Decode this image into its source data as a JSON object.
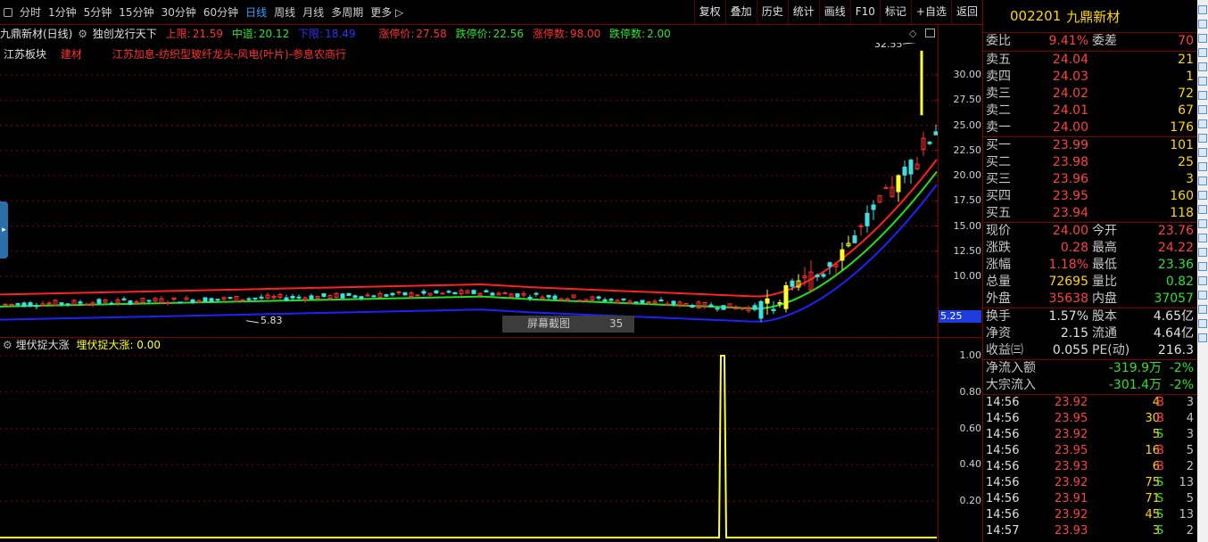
{
  "toolbar": {
    "periods": [
      {
        "label": "分时"
      },
      {
        "label": "1分钟"
      },
      {
        "label": "5分钟"
      },
      {
        "label": "15分钟"
      },
      {
        "label": "30分钟"
      },
      {
        "label": "60分钟"
      },
      {
        "label": "日线",
        "active": true
      },
      {
        "label": "周线"
      },
      {
        "label": "月线"
      },
      {
        "label": "多周期"
      },
      {
        "label": "更多 ▷"
      }
    ],
    "tools": [
      "复权",
      "叠加",
      "历史",
      "统计",
      "画线",
      "F10",
      "标记",
      "+自选",
      "返回"
    ]
  },
  "info": {
    "stock_title": "九鼎新材(日线)",
    "indicator_name": "独创龙行天下",
    "upper_label": "上限:",
    "upper_value": "21.59",
    "mid_label": "中道:",
    "mid_value": "20.12",
    "lower_label": "下限:",
    "lower_value": "18.49",
    "limit_up_label": "涨停价:",
    "limit_up_value": "27.58",
    "limit_down_label": "跌停价:",
    "limit_down_value": "22.56",
    "limit_up_count_label": "涨停数:",
    "limit_up_count_value": "98.00",
    "limit_down_count_label": "跌停数:",
    "limit_down_count_value": "2.00"
  },
  "tags": {
    "sector": "江苏板块",
    "industry": "建材",
    "concepts": "江苏加息-纺织型玻纤龙头-风电(叶片)-参息农商行"
  },
  "main_chart": {
    "y_ticks": [
      "30.00",
      "27.50",
      "25.00",
      "22.50",
      "20.00",
      "17.50",
      "15.00",
      "12.50",
      "10.00"
    ],
    "high_label": "32.55",
    "low_label": "5.83",
    "current_price_tag": "5.25",
    "colors": {
      "upper": "#ff2020",
      "middle": "#20e020",
      "lower": "#2020ff",
      "up_candle": "#ff3030",
      "down_candle": "#40e0e0",
      "highlight": "#ffff30"
    }
  },
  "popup": {
    "label": "屏幕截图",
    "value": "35"
  },
  "sub_chart": {
    "indicator_name": "埋伏捉大涨",
    "value_label": "埋伏捉大涨: 0.00",
    "y_ticks": [
      "1.00",
      "0.80",
      "0.60",
      "0.40",
      "0.20"
    ],
    "signal_value": 1.0,
    "baseline_value": 0.0
  },
  "quote": {
    "code": "002201",
    "name": "九鼎新材",
    "weibi_label": "委比",
    "weibi_value": "9.41%",
    "weicha_label": "委差",
    "weicha_value": "70",
    "asks": [
      {
        "label": "卖五",
        "price": "24.04",
        "vol": "21"
      },
      {
        "label": "卖四",
        "price": "24.03",
        "vol": "1"
      },
      {
        "label": "卖三",
        "price": "24.02",
        "vol": "72"
      },
      {
        "label": "卖二",
        "price": "24.01",
        "vol": "67"
      },
      {
        "label": "卖一",
        "price": "24.00",
        "vol": "176"
      }
    ],
    "bids": [
      {
        "label": "买一",
        "price": "23.99",
        "vol": "101"
      },
      {
        "label": "买二",
        "price": "23.98",
        "vol": "25"
      },
      {
        "label": "买三",
        "price": "23.96",
        "vol": "3"
      },
      {
        "label": "买四",
        "price": "23.95",
        "vol": "160"
      },
      {
        "label": "买五",
        "price": "23.94",
        "vol": "118"
      }
    ],
    "stats": [
      {
        "l1": "现价",
        "v1": "24.00",
        "l2": "今开",
        "v2": "23.76",
        "c1": "#ff4040",
        "c2": "#ff4040"
      },
      {
        "l1": "涨跌",
        "v1": "0.28",
        "l2": "最高",
        "v2": "24.22",
        "c1": "#ff4040",
        "c2": "#ff4040"
      },
      {
        "l1": "涨幅",
        "v1": "1.18%",
        "l2": "最低",
        "v2": "23.36",
        "c1": "#ff4040",
        "c2": "#30e030"
      },
      {
        "l1": "总量",
        "v1": "72695",
        "l2": "量比",
        "v2": "0.82",
        "c1": "#ffd700",
        "c2": "#30e030"
      },
      {
        "l1": "外盘",
        "v1": "35638",
        "l2": "内盘",
        "v2": "37057",
        "c1": "#ff4040",
        "c2": "#30e030"
      }
    ],
    "stats2": [
      {
        "l1": "换手",
        "v1": "1.57%",
        "l2": "股本",
        "v2": "4.65亿"
      },
      {
        "l1": "净资",
        "v1": "2.15",
        "l2": "流通",
        "v2": "4.64亿"
      },
      {
        "l1": "收益㈢",
        "v1": "0.055",
        "l2": "PE(动)",
        "v2": "216.3"
      }
    ],
    "flows": [
      {
        "label": "净流入额",
        "value": "-319.9万",
        "pct": "-2%"
      },
      {
        "label": "大宗流入",
        "value": "-301.4万",
        "pct": "-2%"
      }
    ],
    "ticks": [
      {
        "time": "14:56",
        "price": "23.92",
        "vol": "4",
        "side": "B",
        "n": "3"
      },
      {
        "time": "14:56",
        "price": "23.95",
        "vol": "30",
        "side": "B",
        "n": "4"
      },
      {
        "time": "14:56",
        "price": "23.92",
        "vol": "5",
        "side": "S",
        "n": "3"
      },
      {
        "time": "14:56",
        "price": "23.95",
        "vol": "16",
        "side": "B",
        "n": "5"
      },
      {
        "time": "14:56",
        "price": "23.93",
        "vol": "6",
        "side": "B",
        "n": "2"
      },
      {
        "time": "14:56",
        "price": "23.92",
        "vol": "75",
        "side": "S",
        "n": "13"
      },
      {
        "time": "14:56",
        "price": "23.91",
        "vol": "71",
        "side": "S",
        "n": "5"
      },
      {
        "time": "14:56",
        "price": "23.92",
        "vol": "45",
        "side": "S",
        "n": "13"
      },
      {
        "time": "14:57",
        "price": "23.93",
        "vol": "3",
        "side": "S",
        "n": "2"
      }
    ]
  }
}
